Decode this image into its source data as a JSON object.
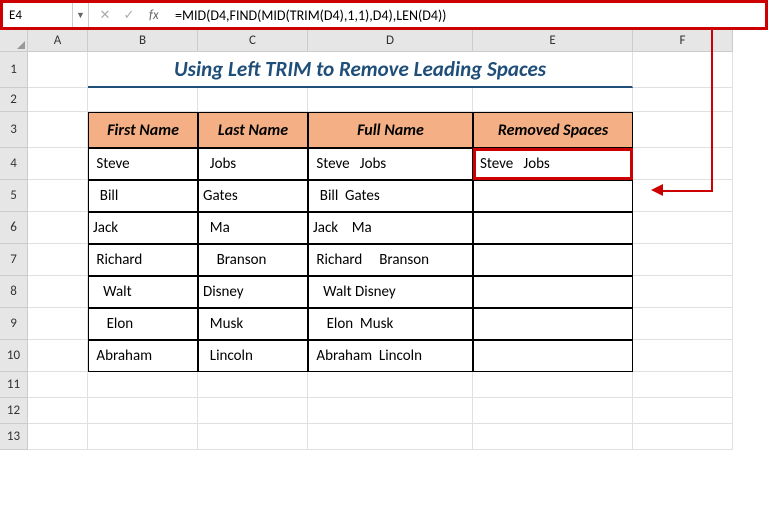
{
  "name_box": "E4",
  "formula": "=MID(D4,FIND(MID(TRIM(D4),1,1),D4),LEN(D4))",
  "columns": [
    "A",
    "B",
    "C",
    "D",
    "E",
    "F"
  ],
  "row_numbers": [
    "1",
    "2",
    "3",
    "4",
    "5",
    "6",
    "7",
    "8",
    "9",
    "10",
    "11",
    "12",
    "13"
  ],
  "title": "Using Left TRIM to Remove Leading Spaces",
  "headers": {
    "first_name": "First Name",
    "last_name": "Last Name",
    "full_name": "Full Name",
    "removed_spaces": "Removed Spaces"
  },
  "table": [
    {
      "first": " Steve",
      "last": "  Jobs",
      "full": " Steve   Jobs",
      "result": "Steve   Jobs"
    },
    {
      "first": "  Bill",
      "last": "Gates",
      "full": "  Bill  Gates",
      "result": ""
    },
    {
      "first": "Jack",
      "last": "  Ma",
      "full": "Jack    Ma",
      "result": ""
    },
    {
      "first": " Richard",
      "last": "    Branson",
      "full": " Richard     Branson",
      "result": ""
    },
    {
      "first": "   Walt",
      "last": "Disney",
      "full": "   Walt Disney",
      "result": ""
    },
    {
      "first": "    Elon",
      "last": "  Musk",
      "full": "    Elon  Musk",
      "result": ""
    },
    {
      "first": " Abraham",
      "last": "  Lincoln",
      "full": " Abraham  Lincoln",
      "result": ""
    }
  ],
  "chart_data": {
    "type": "table",
    "title": "Using Left TRIM to Remove Leading Spaces",
    "columns": [
      "First Name",
      "Last Name",
      "Full Name",
      "Removed Spaces"
    ],
    "rows": [
      [
        " Steve",
        "  Jobs",
        " Steve   Jobs",
        "Steve   Jobs"
      ],
      [
        "  Bill",
        "Gates",
        "  Bill  Gates",
        ""
      ],
      [
        "Jack",
        "  Ma",
        "Jack    Ma",
        ""
      ],
      [
        " Richard",
        "    Branson",
        " Richard     Branson",
        ""
      ],
      [
        "   Walt",
        "Disney",
        "   Walt Disney",
        ""
      ],
      [
        "    Elon",
        "  Musk",
        "    Elon  Musk",
        ""
      ],
      [
        " Abraham",
        "  Lincoln",
        " Abraham  Lincoln",
        ""
      ]
    ]
  }
}
